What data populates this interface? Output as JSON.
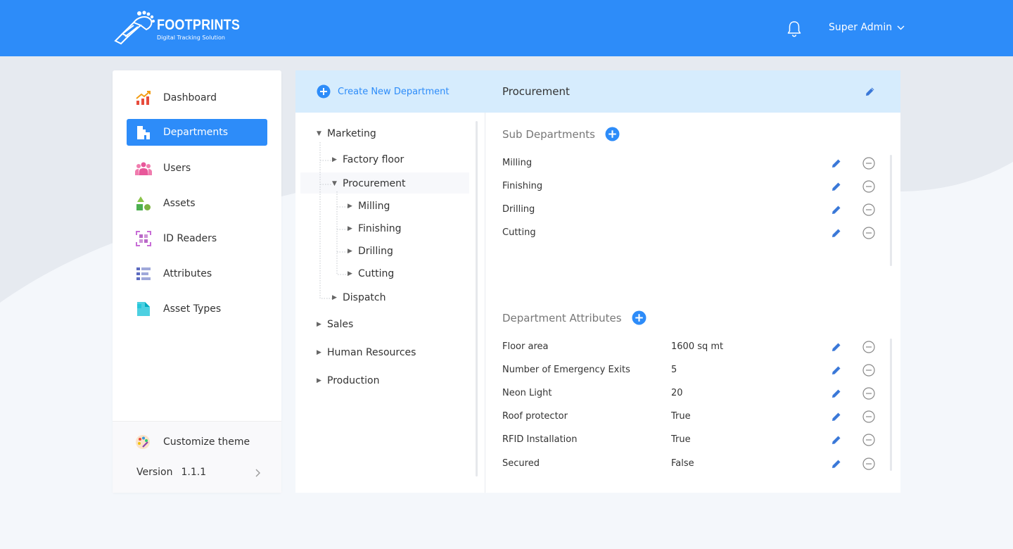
{
  "brand": {
    "name": "FOOTPRINTS",
    "tagline": "Digital Tracking Solution"
  },
  "header": {
    "user_name": "Super Admin",
    "accent": "#2d8cf9"
  },
  "sidebar": {
    "items": [
      {
        "label": "Dashboard",
        "icon": "chart-icon"
      },
      {
        "label": "Departments",
        "icon": "building-icon",
        "active": true
      },
      {
        "label": "Users",
        "icon": "users-icon"
      },
      {
        "label": "Assets",
        "icon": "shapes-icon"
      },
      {
        "label": "ID Readers",
        "icon": "qr-scan-icon"
      },
      {
        "label": "Attributes",
        "icon": "list-icon"
      },
      {
        "label": "Asset Types",
        "icon": "file-icon"
      }
    ],
    "theme_label": "Customize theme",
    "version_label": "Version",
    "version_value": "1.1.1"
  },
  "tree": {
    "create_label": "Create New Department",
    "nodes": [
      {
        "label": "Marketing",
        "expanded": true
      },
      {
        "label": "Factory floor"
      },
      {
        "label": "Procurement",
        "expanded": true,
        "selected": true
      },
      {
        "label": "Milling"
      },
      {
        "label": "Finishing"
      },
      {
        "label": "Drilling"
      },
      {
        "label": "Cutting"
      },
      {
        "label": "Dispatch"
      },
      {
        "label": "Sales"
      },
      {
        "label": "Human Resources"
      },
      {
        "label": "Production"
      }
    ]
  },
  "detail": {
    "title": "Procurement",
    "sub_title": "Sub Departments",
    "subs": [
      "Milling",
      "Finishing",
      "Drilling",
      "Cutting"
    ],
    "attr_title": "Department Attributes",
    "attrs": [
      {
        "name": "Floor area",
        "value": "1600 sq mt"
      },
      {
        "name": "Number of Emergency Exits",
        "value": "5"
      },
      {
        "name": "Neon Light",
        "value": "20"
      },
      {
        "name": "Roof protector",
        "value": "True"
      },
      {
        "name": "RFID Installation",
        "value": "True"
      },
      {
        "name": "Secured",
        "value": "False"
      }
    ]
  }
}
